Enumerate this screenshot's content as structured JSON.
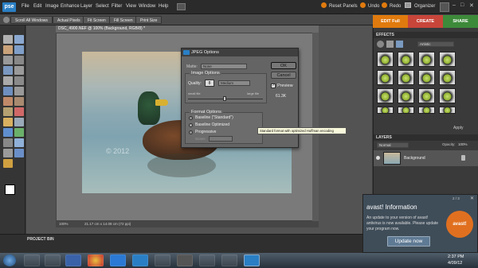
{
  "app": {
    "logo": "pse"
  },
  "menubar": {
    "items": [
      "File",
      "Edit",
      "Image",
      "Enhance",
      "Layer",
      "Select",
      "Filter",
      "View",
      "Window",
      "Help"
    ],
    "right": {
      "reset_panels": "Reset Panels",
      "undo": "Undo",
      "redo": "Redo",
      "organizer": "Organizer"
    }
  },
  "options_bar": {
    "buttons": [
      "Scroll All Windows",
      "Actual Pixels",
      "Fit Screen",
      "Fill Screen",
      "Print Size"
    ]
  },
  "edit_tabs": {
    "edit_full": "EDIT Full",
    "create": "CREATE",
    "share": "SHARE"
  },
  "document": {
    "tab_title": "DSC_4900.NEF @ 100% (Background, RGB/8) *",
    "zoom": "100%",
    "dimensions": "21.17 cm x 14.08 cm (72 ppi)",
    "watermark": "© 2012"
  },
  "project_bin": {
    "label": "PROJECT BIN"
  },
  "dialog": {
    "title": "JPEG Options",
    "matte_label": "Matte:",
    "matte_value": "None",
    "image_options": "Image Options",
    "quality_label": "Quality:",
    "quality_value": "8",
    "quality_preset": "Medium",
    "small_file": "small file",
    "large_file": "large file",
    "ok": "OK",
    "cancel": "Cancel",
    "preview": "Preview",
    "size": "61.3K",
    "format_options": "Format Options",
    "baseline_standard": "Baseline (\"Standard\")",
    "baseline_optimized": "Baseline Optimized",
    "progressive": "Progressive",
    "scans_label": "Scans:",
    "scans_value": "3"
  },
  "tooltip": "Standard format with optimized Huffman encoding",
  "effects_panel": {
    "title": "EFFECTS",
    "dropdown": "Artistic",
    "apply": "Apply"
  },
  "layers_panel": {
    "title": "LAYERS",
    "blend_mode": "Normal",
    "opacity_label": "Opacity:",
    "opacity_value": "100%",
    "layer_name": "Background"
  },
  "avast": {
    "title": "avast! Information",
    "brand": "avast!",
    "message": "An update to your version of avast! antivirus is now available. Please update your program now.",
    "button": "Update now",
    "counter": "2 / 3"
  },
  "taskbar": {
    "time": "2:37 PM",
    "date": "4/09/12"
  },
  "colors": {
    "edit_full": "#e07a0e",
    "create": "#c8453a",
    "share": "#3d8a3a",
    "ps_blue": "#2a7fc4"
  }
}
